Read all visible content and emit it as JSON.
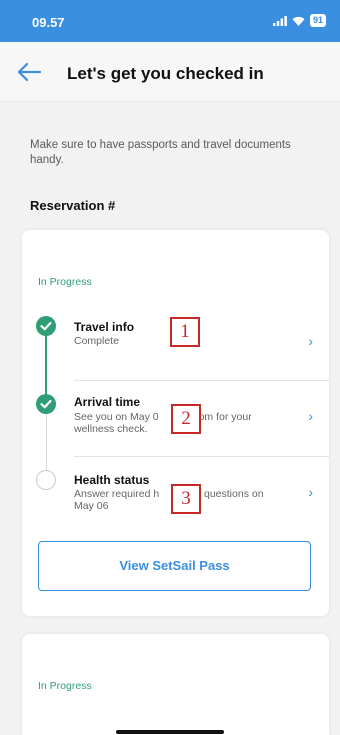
{
  "status_bar": {
    "time": "09.57",
    "battery": "91"
  },
  "header": {
    "title": "Let's get you checked in"
  },
  "intro": "Make sure to have passports and travel documents handy.",
  "reservation_label": "Reservation #",
  "card": {
    "status": "In Progress",
    "steps": [
      {
        "title": "Travel info",
        "subtitle": "Complete",
        "state": "done",
        "annotation": "1"
      },
      {
        "title": "Arrival time",
        "subtitle_line1": "See you on May 0",
        "subtitle_line1_tail": "30 pm for your",
        "subtitle_line2": "wellness check.",
        "state": "done",
        "annotation": "2"
      },
      {
        "title": "Health status",
        "subtitle_line1": "Answer required h",
        "subtitle_line1_tail": "questions on",
        "subtitle_line2": "May 06",
        "state": "pending",
        "annotation": "3"
      }
    ],
    "pass_button": "View SetSail Pass"
  },
  "card2": {
    "status": "In Progress"
  },
  "colors": {
    "accent": "#3b8fe0",
    "success": "#2f9e74",
    "annotation": "#c62828"
  },
  "icons": {
    "back": "arrow-left-icon",
    "chevron": "chevron-right-icon",
    "check": "check-icon"
  }
}
